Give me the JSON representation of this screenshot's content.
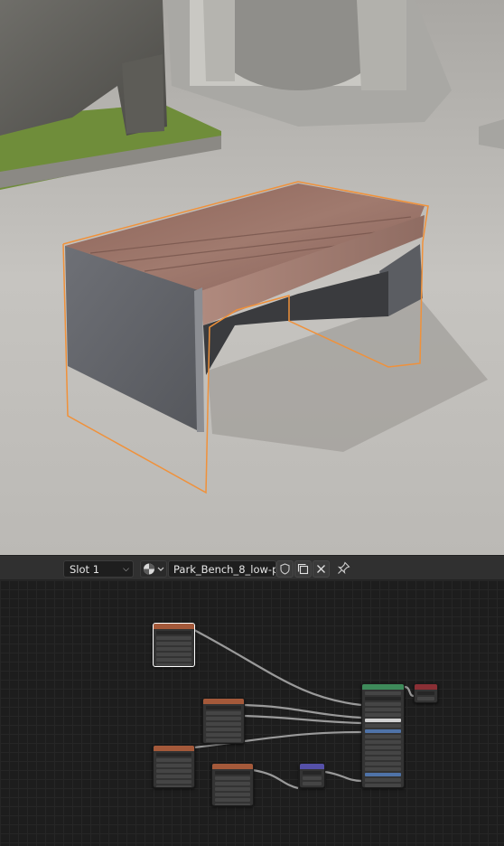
{
  "header": {
    "slot_label": "Slot 1",
    "material_name": "Park_Bench_8_low-p...",
    "icons": [
      "material-sphere-icon",
      "chevron-down-icon",
      "fake-user-shield-icon",
      "duplicate-icon",
      "close-icon",
      "pin-icon"
    ]
  },
  "colors": {
    "selection_outline": "#f0913a",
    "texture_node_header": "#a4593a",
    "shader_node_header": "#3e8a5a",
    "output_node_header": "#8a2f35",
    "vector_node_header": "#5550a8",
    "editor_background": "#1d1d1d"
  },
  "node_editor": {
    "nodes": [
      {
        "kind": "image-texture",
        "selected": true
      },
      {
        "kind": "image-texture",
        "selected": false
      },
      {
        "kind": "image-texture",
        "selected": false
      },
      {
        "kind": "image-texture",
        "selected": false
      },
      {
        "kind": "normal-map",
        "selected": false
      },
      {
        "kind": "principled-bsdf",
        "selected": false
      },
      {
        "kind": "material-output",
        "selected": false
      }
    ]
  }
}
